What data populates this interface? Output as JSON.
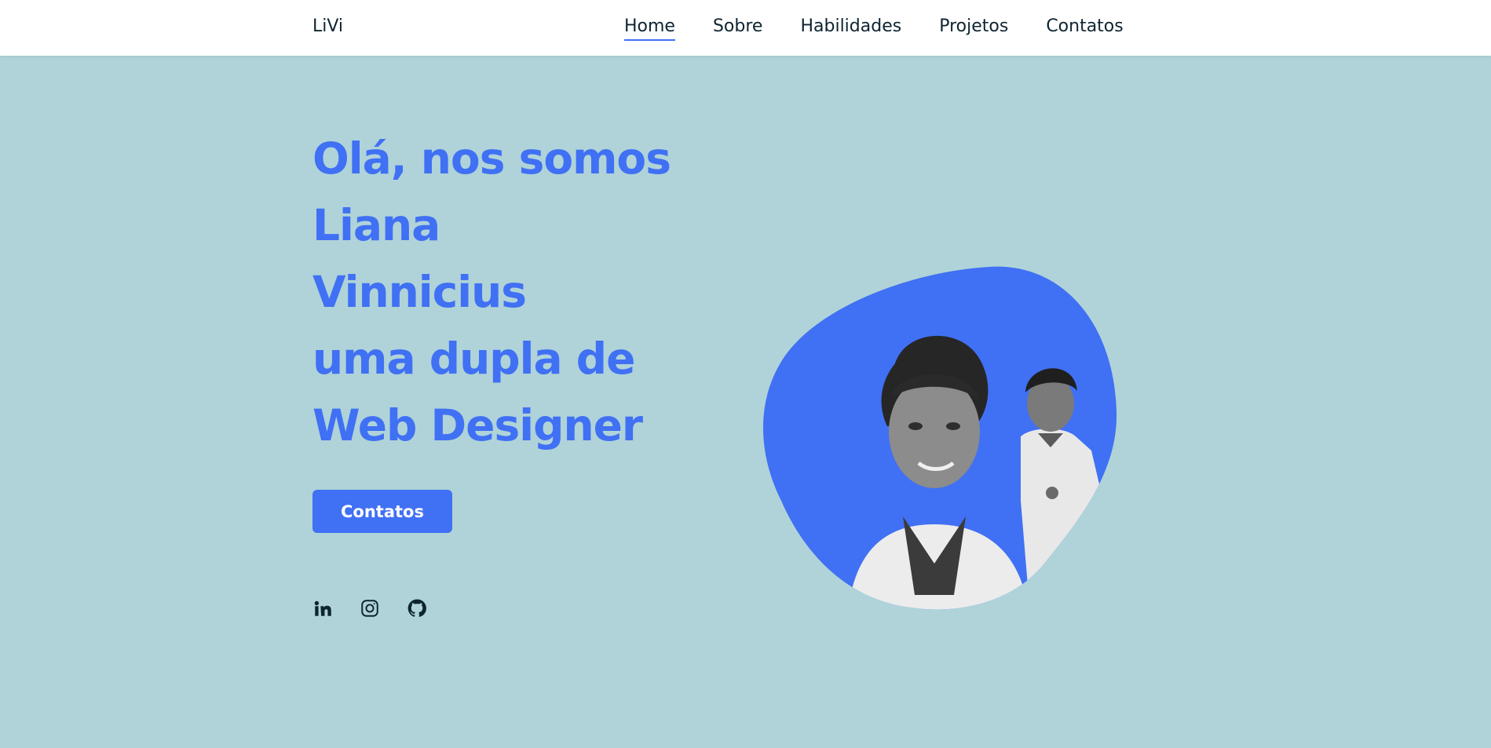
{
  "header": {
    "logo": "LiVi",
    "nav": [
      {
        "label": "Home",
        "active": true
      },
      {
        "label": "Sobre",
        "active": false
      },
      {
        "label": "Habilidades",
        "active": false
      },
      {
        "label": "Projetos",
        "active": false
      },
      {
        "label": "Contatos",
        "active": false
      }
    ]
  },
  "hero": {
    "lines": [
      "Olá, nos somos",
      "Liana",
      "Vinnicius",
      "uma dupla de",
      "Web Designer"
    ],
    "button_label": "Contatos",
    "socials": [
      "linkedin-icon",
      "instagram-icon",
      "github-icon"
    ]
  },
  "colors": {
    "background": "#afd3d8",
    "accent": "#4070f4",
    "text": "#0e2431",
    "header_bg": "#ffffff"
  }
}
